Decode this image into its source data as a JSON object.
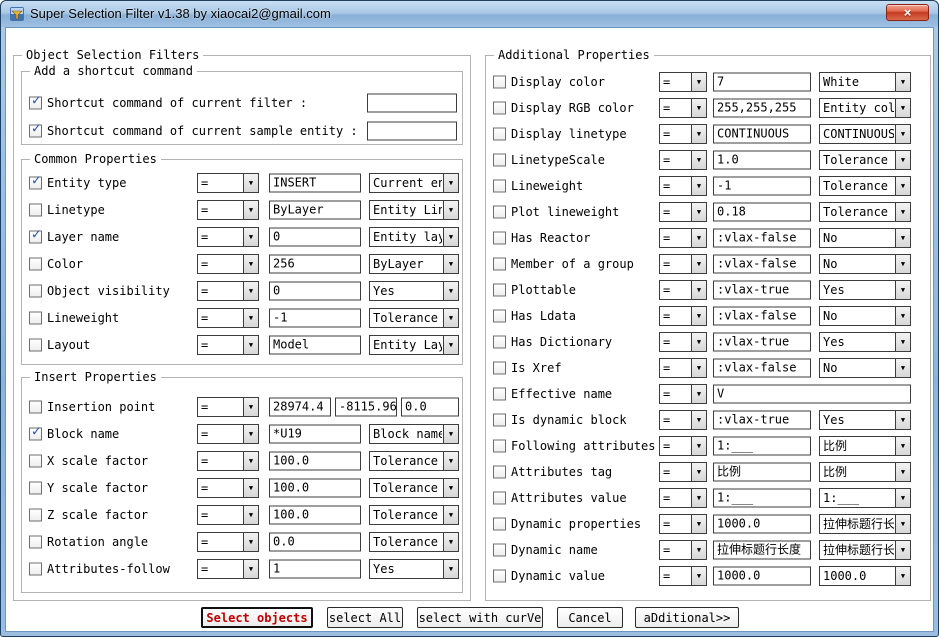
{
  "window": {
    "title": "Super Selection Filter v1.38 by xiaocai2@gmail.com"
  },
  "sections": {
    "object_filters": "Object Selection Filters",
    "shortcut": "Add a shortcut command",
    "common": "Common Properties",
    "insert": "Insert Properties",
    "additional": "Additional Properties"
  },
  "shortcut_rows": [
    {
      "checked": true,
      "label": "Shortcut command of current filter :",
      "value": ""
    },
    {
      "checked": true,
      "label": "Shortcut command of current sample entity :",
      "value": ""
    }
  ],
  "common_rows": [
    {
      "checked": true,
      "label": "Entity type",
      "op": "=",
      "value": "INSERT",
      "mode": "Current ent"
    },
    {
      "checked": false,
      "label": "Linetype",
      "op": "=",
      "value": "ByLayer",
      "mode": "Entity Line"
    },
    {
      "checked": true,
      "label": "Layer name",
      "op": "=",
      "value": "0",
      "mode": "Entity laye"
    },
    {
      "checked": false,
      "label": "Color",
      "op": "=",
      "value": "256",
      "mode": "ByLayer"
    },
    {
      "checked": false,
      "label": "Object visibility",
      "op": "=",
      "value": "0",
      "mode": "Yes"
    },
    {
      "checked": false,
      "label": "Lineweight",
      "op": "=",
      "value": "-1",
      "mode": "Tolerance"
    },
    {
      "checked": false,
      "label": "Layout",
      "op": "=",
      "value": "Model",
      "mode": "Entity Layo"
    }
  ],
  "insert_rows": [
    {
      "checked": false,
      "label": "Insertion point",
      "op": "=",
      "values": [
        "28974.4",
        "-8115.96",
        "0.0"
      ]
    },
    {
      "checked": true,
      "label": "Block name",
      "op": "=",
      "value": "*U19",
      "mode": "Block name"
    },
    {
      "checked": false,
      "label": "X scale factor",
      "op": "=",
      "value": "100.0",
      "mode": "Tolerance"
    },
    {
      "checked": false,
      "label": "Y scale factor",
      "op": "=",
      "value": "100.0",
      "mode": "Tolerance"
    },
    {
      "checked": false,
      "label": "Z scale factor",
      "op": "=",
      "value": "100.0",
      "mode": "Tolerance"
    },
    {
      "checked": false,
      "label": "Rotation angle",
      "op": "=",
      "value": "0.0",
      "mode": "Tolerance"
    },
    {
      "checked": false,
      "label": "Attributes-follow",
      "op": "=",
      "value": "1",
      "mode": "Yes"
    }
  ],
  "additional_rows": [
    {
      "checked": false,
      "label": "Display color",
      "op": "=",
      "value": "7",
      "mode": "White"
    },
    {
      "checked": false,
      "label": "Display RGB color",
      "op": "=",
      "value": "255,255,255",
      "mode": "Entity colo"
    },
    {
      "checked": false,
      "label": "Display linetype",
      "op": "=",
      "value": "CONTINUOUS",
      "mode": "CONTINUOUS"
    },
    {
      "checked": false,
      "label": "LinetypeScale",
      "op": "=",
      "value": "1.0",
      "mode": "Tolerance"
    },
    {
      "checked": false,
      "label": "Lineweight",
      "op": "=",
      "value": "-1",
      "mode": "Tolerance"
    },
    {
      "checked": false,
      "label": "Plot lineweight",
      "op": "=",
      "value": "0.18",
      "mode": "Tolerance"
    },
    {
      "checked": false,
      "label": "Has Reactor",
      "op": "=",
      "value": ":vlax-false",
      "mode": "No"
    },
    {
      "checked": false,
      "label": "Member of a group",
      "op": "=",
      "value": ":vlax-false",
      "mode": "No"
    },
    {
      "checked": false,
      "label": "Plottable",
      "op": "=",
      "value": ":vlax-true",
      "mode": "Yes"
    },
    {
      "checked": false,
      "label": "Has Ldata",
      "op": "=",
      "value": ":vlax-false",
      "mode": "No"
    },
    {
      "checked": false,
      "label": "Has Dictionary",
      "op": "=",
      "value": ":vlax-true",
      "mode": "Yes"
    },
    {
      "checked": false,
      "label": "Is Xref",
      "op": "=",
      "value": ":vlax-false",
      "mode": "No"
    },
    {
      "checked": false,
      "label": "Effective name",
      "op": "=",
      "value": "V",
      "wide": true
    },
    {
      "checked": false,
      "label": "Is dynamic block",
      "op": "=",
      "value": ":vlax-true",
      "mode": "Yes"
    },
    {
      "checked": false,
      "label": "Following attributes",
      "op": "=",
      "value": "1:___",
      "mode": "比例"
    },
    {
      "checked": false,
      "label": "Attributes tag",
      "op": "=",
      "value": "比例",
      "mode": "比例"
    },
    {
      "checked": false,
      "label": "Attributes value",
      "op": "=",
      "value": "1:___",
      "mode": "1:___"
    },
    {
      "checked": false,
      "label": "Dynamic properties",
      "op": "=",
      "value": "1000.0",
      "mode": "拉伸标题行长"
    },
    {
      "checked": false,
      "label": "Dynamic name",
      "op": "=",
      "value": "拉伸标题行长度",
      "mode": "拉伸标题行长"
    },
    {
      "checked": false,
      "label": "Dynamic value",
      "op": "=",
      "value": "1000.0",
      "mode": "1000.0"
    }
  ],
  "buttons": [
    {
      "label": "Select objects",
      "accent": true
    },
    {
      "label": "select All",
      "accent": false
    },
    {
      "label": "select with curVe",
      "accent": false
    },
    {
      "label": "Cancel",
      "accent": false
    },
    {
      "label": "aDditional>>",
      "accent": false
    }
  ]
}
